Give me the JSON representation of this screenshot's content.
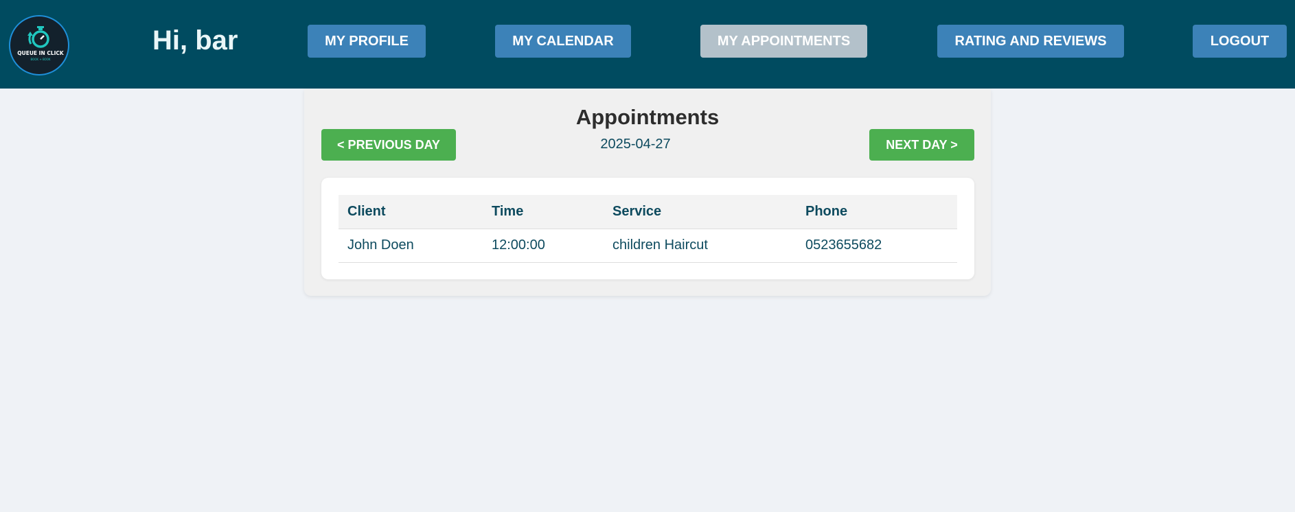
{
  "header": {
    "greeting": "Hi, bar",
    "logo": {
      "icon": "stopwatch-icon",
      "text": "QUEUE IN CLICK",
      "tagline": "BOOK + BOOK",
      "colors": {
        "background": "#13212c",
        "ring": "#1f8fd9",
        "icon": "#20c7c0"
      }
    },
    "nav": {
      "profile": "MY PROFILE",
      "calendar": "MY CALENDAR",
      "appointments": "MY APPOINTMENTS",
      "reviews": "RATING AND REVIEWS",
      "logout": "LOGOUT"
    },
    "active_nav": "appointments"
  },
  "appointments": {
    "title": "Appointments",
    "prev_label": "< PREVIOUS DAY",
    "next_label": "NEXT DAY >",
    "date": "2025-04-27",
    "columns": {
      "client": "Client",
      "time": "Time",
      "service": "Service",
      "phone": "Phone"
    },
    "rows": [
      {
        "client": "John Doen",
        "time": "12:00:00",
        "service": "children Haircut",
        "phone": "0523655682"
      }
    ]
  },
  "colors": {
    "header_bg": "#004b60",
    "page_bg": "#eff2f6",
    "nav_button": "#3c82b8",
    "nav_active": "#b3c1ca",
    "day_button": "#4caf50",
    "text_primary": "#0d4a5e"
  }
}
